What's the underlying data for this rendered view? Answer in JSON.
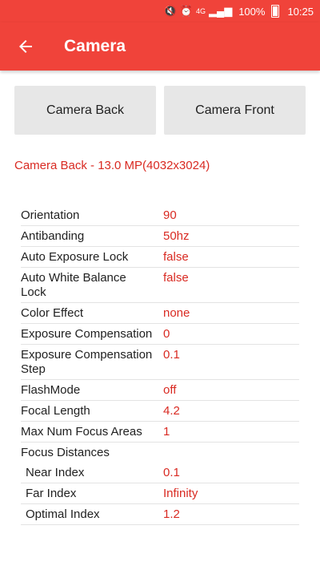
{
  "status_bar": {
    "network": "4G",
    "battery": "100%",
    "time": "10:25"
  },
  "toolbar": {
    "title": "Camera"
  },
  "buttons": {
    "back_camera": "Camera Back",
    "front_camera": "Camera Front"
  },
  "camera_info": "Camera Back - 13.0 MP(4032x3024)",
  "properties": [
    {
      "label": "Orientation",
      "value": "90"
    },
    {
      "label": "Antibanding",
      "value": "50hz"
    },
    {
      "label": "Auto Exposure Lock",
      "value": "false"
    },
    {
      "label": "Auto White Balance Lock",
      "value": "false"
    },
    {
      "label": "Color Effect",
      "value": "none"
    },
    {
      "label": "Exposure Compensation",
      "value": "0"
    },
    {
      "label": "Exposure Compensation Step",
      "value": "0.1"
    },
    {
      "label": "FlashMode",
      "value": "off"
    },
    {
      "label": "Focal Length",
      "value": "4.2"
    },
    {
      "label": "Max Num Focus Areas",
      "value": "1"
    }
  ],
  "focus_distances": {
    "label": "Focus Distances",
    "items": [
      {
        "label": "Near Index",
        "value": "0.1"
      },
      {
        "label": "Far Index",
        "value": "Infinity"
      },
      {
        "label": "Optimal Index",
        "value": "1.2"
      }
    ]
  },
  "colors": {
    "accent": "#f0433a",
    "value_text": "#d92a22",
    "button_bg": "#e7e7e7"
  }
}
